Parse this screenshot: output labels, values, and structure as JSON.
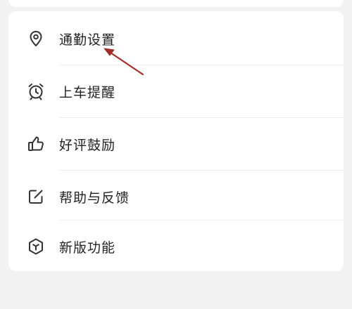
{
  "menu": {
    "items": [
      {
        "label": "通勤设置",
        "icon": "location-pin-icon"
      },
      {
        "label": "上车提醒",
        "icon": "alarm-clock-icon"
      },
      {
        "label": "好评鼓励",
        "icon": "thumbs-up-icon"
      },
      {
        "label": "帮助与反馈",
        "icon": "edit-square-icon"
      },
      {
        "label": "新版功能",
        "icon": "cube-icon"
      }
    ]
  },
  "colors": {
    "background": "#f2f2f2",
    "card": "#ffffff",
    "text": "#222222",
    "annotation_arrow": "#a52a2a"
  }
}
